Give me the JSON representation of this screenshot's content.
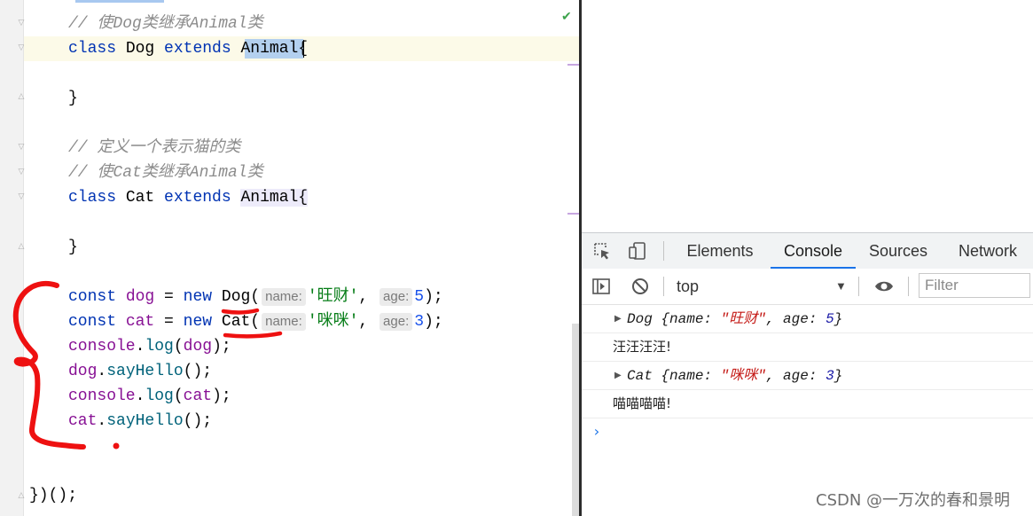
{
  "editor": {
    "lines": {
      "comment_dog": "// 使Dog类继承Animal类",
      "kw_class": "class",
      "kw_extends": "extends",
      "cls_dog": "Dog",
      "cls_cat": "Cat",
      "cls_animal": "Animal",
      "brace_open": "{",
      "brace_close": "}",
      "comment_cat_def": "// 定义一个表示猫的类",
      "comment_cat_extends": "// 使Cat类继承Animal类",
      "kw_const": "const",
      "kw_new": "new",
      "var_dog": "dog",
      "var_cat": "cat",
      "eq": "=",
      "paren_open": "(",
      "hint_name": "name:",
      "hint_age": "age:",
      "str_dog": "'旺财'",
      "str_cat": "'咪咪'",
      "comma": ",",
      "num_dog": "5",
      "num_cat": "3",
      "call_end": ");",
      "console": "console",
      "dot": ".",
      "log": "log",
      "say_hello": "sayHello",
      "empty_call": "();",
      "iife_end": "})();"
    }
  },
  "devtools": {
    "tabs": [
      "Elements",
      "Console",
      "Sources",
      "Network"
    ],
    "active_tab": "Console",
    "context": "top",
    "filter_placeholder": "Filter",
    "console": {
      "dog_obj": {
        "cls": "Dog",
        "open": " {",
        "name_key": "name: ",
        "name_val": "\"旺财\"",
        "sep": ", ",
        "age_key": "age: ",
        "age_val": "5",
        "close": "}"
      },
      "dog_msg": "汪汪汪汪!",
      "cat_obj": {
        "cls": "Cat",
        "open": " {",
        "name_key": "name: ",
        "name_val": "\"咪咪\"",
        "sep": ", ",
        "age_key": "age: ",
        "age_val": "3",
        "close": "}"
      },
      "cat_msg": "喵喵喵喵!",
      "prompt": "›"
    }
  },
  "watermark": "CSDN @一万次的春和景明",
  "colors": {
    "keyword": "#0033b3",
    "comment": "#8c8c8c",
    "string": "#067d17",
    "number": "#1750eb",
    "annotation": "#ee1111",
    "tab_accent": "#1a73e8"
  }
}
